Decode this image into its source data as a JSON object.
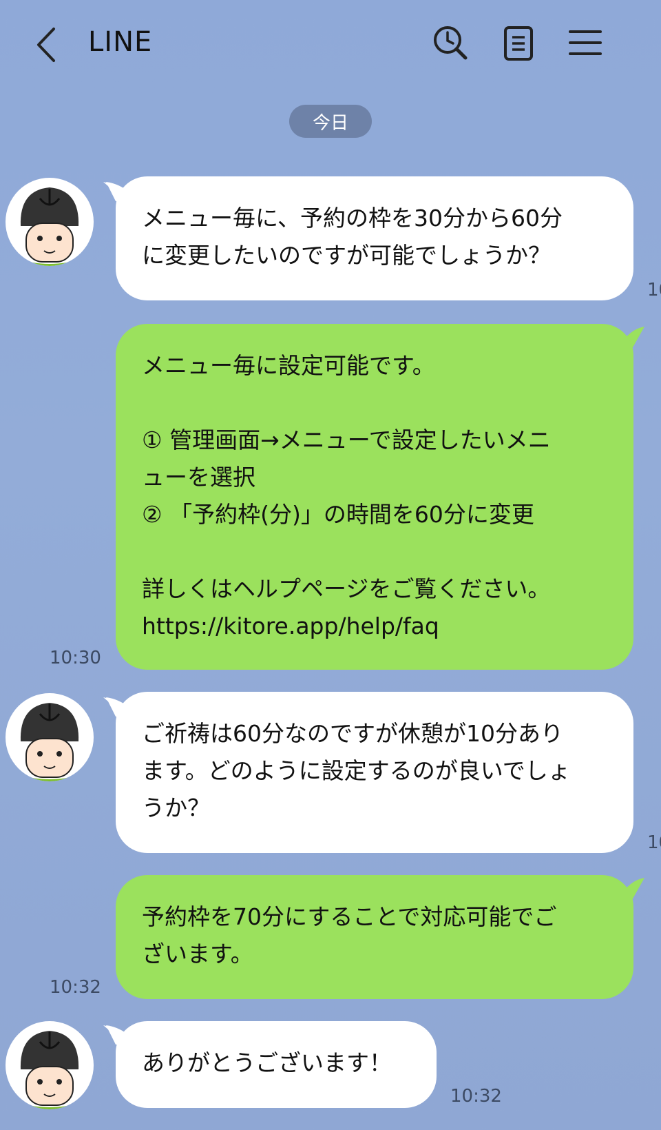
{
  "header": {
    "title": "LINE"
  },
  "date_label": "今日",
  "messages": [
    {
      "side": "in",
      "text": "メニュー毎に、予約の枠を30分から60分\nに変更したいのですが可能でしょうか？",
      "time": "10"
    },
    {
      "side": "out",
      "text": "メニュー毎に設定可能です。\n\n① 管理画面→メニューで設定したいメニ\nューを選択\n② 「予約枠(分)」の時間を60分に変更\n\n詳しくはヘルプページをご覧ください。\nhttps://kitore.app/help/faq",
      "time": "10:30"
    },
    {
      "side": "in",
      "text": "ご祈祷は60分なのですが休憩が10分あり\nます。どのように設定するのが良いでしょ\nうか？",
      "time": "10"
    },
    {
      "side": "out",
      "text": "予約枠を70分にすることで対応可能でご\nざいます。",
      "time": "10:32"
    },
    {
      "side": "in",
      "text": "ありがとうございます！",
      "time": "10:32"
    }
  ],
  "colors": {
    "background": "#92abd8",
    "incoming_bubble": "#ffffff",
    "outgoing_bubble": "#9be15d",
    "date_pill": "#6e82a8"
  },
  "icons": [
    "back-chevron-icon",
    "search-history-icon",
    "notes-icon",
    "menu-icon"
  ]
}
